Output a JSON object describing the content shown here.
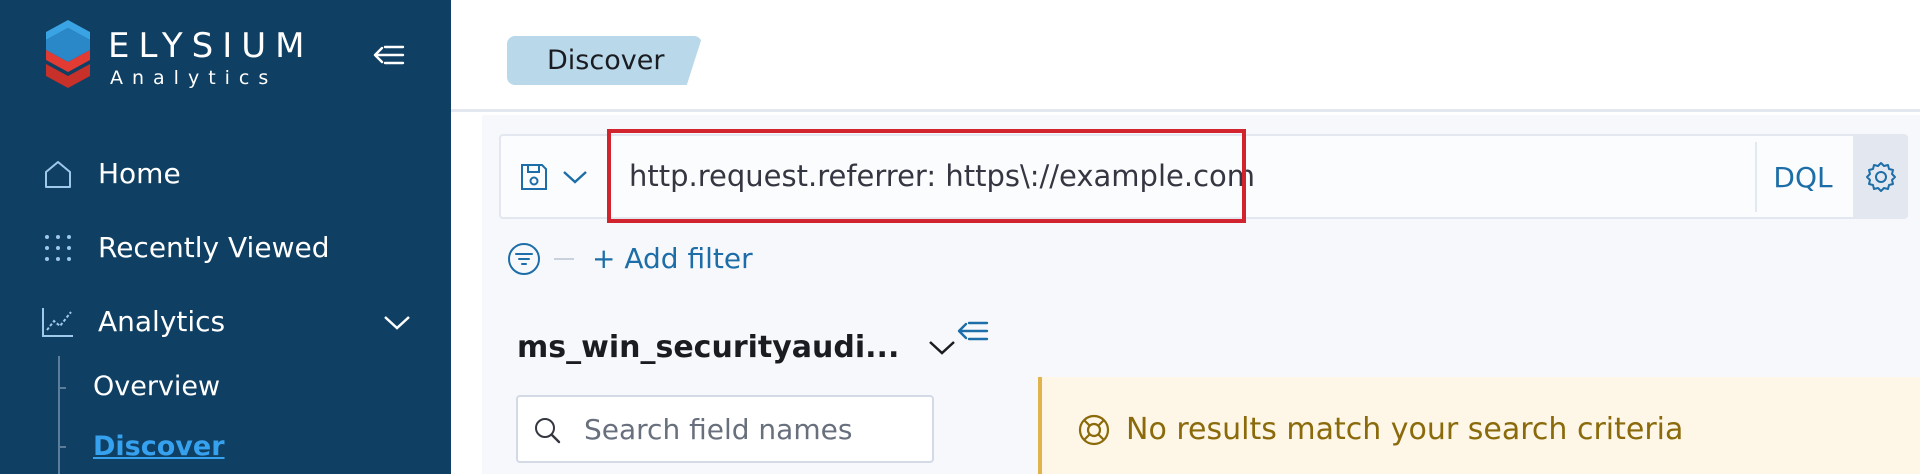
{
  "app": {
    "logo_word": "ELYSIUM",
    "logo_sub": "Analytics"
  },
  "sidebar": {
    "items": [
      {
        "label": "Home",
        "icon": "home-icon"
      },
      {
        "label": "Recently Viewed",
        "icon": "grid-dots-icon"
      },
      {
        "label": "Analytics",
        "icon": "line-chart-icon",
        "expanded": true
      }
    ],
    "sub_items": [
      {
        "label": "Overview",
        "active": false
      },
      {
        "label": "Discover",
        "active": true
      }
    ]
  },
  "header": {
    "breadcrumb": "Discover"
  },
  "querybar": {
    "query_value": "http.request.referrer: https\\://example.com",
    "language_label": "DQL"
  },
  "filters": {
    "add_filter_label": "+ Add filter"
  },
  "index": {
    "name": "ms_win_securityaudi..."
  },
  "field_search": {
    "placeholder": "Search field names"
  },
  "callout": {
    "message": "No results match your search criteria"
  },
  "colors": {
    "sidebar_bg": "#0f3f63",
    "accent": "#1d6ea8",
    "active_link": "#36a2ef",
    "highlight_border": "#d1242f",
    "callout_bg": "#fef6e6",
    "callout_text": "#8a6a0a"
  }
}
